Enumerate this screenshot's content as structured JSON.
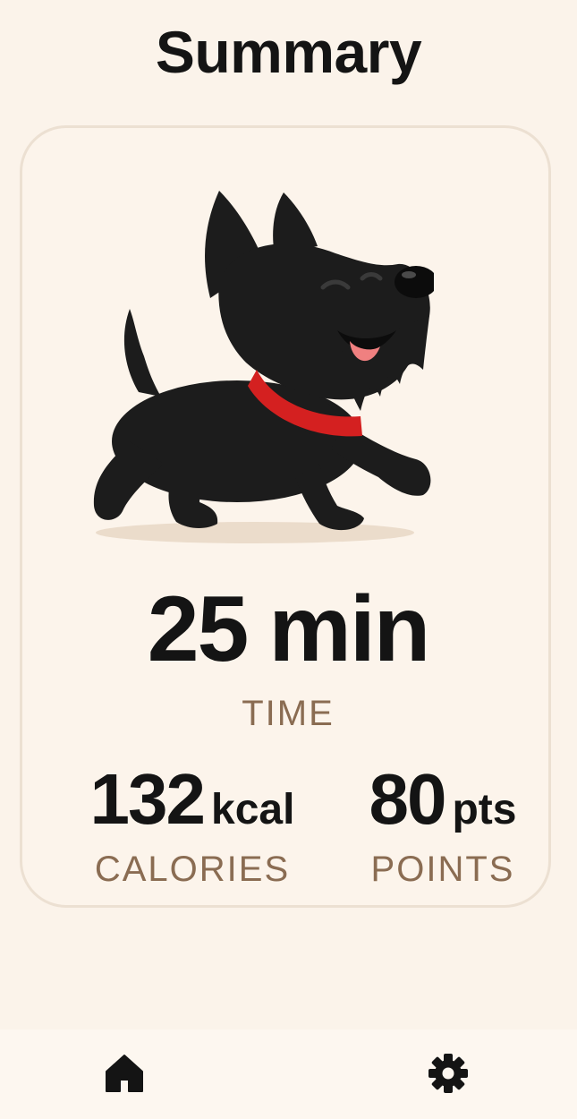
{
  "header": {
    "title": "Summary"
  },
  "summary": {
    "illustration_icon": "scottie-dog-illustration",
    "time": {
      "value": "25",
      "unit": "min",
      "label": "TIME"
    },
    "calories": {
      "value": "132",
      "unit": "kcal",
      "label": "CALORIES"
    },
    "points": {
      "value": "80",
      "unit": "pts",
      "label": "POINTS"
    }
  },
  "nav": {
    "items": [
      {
        "icon": "home-icon",
        "active": true
      },
      {
        "icon": "gear-icon",
        "active": false
      }
    ]
  },
  "colors": {
    "background": "#fbf3ea",
    "card_border": "#ece0d2",
    "label_brown": "#8a6c52",
    "text": "#141414",
    "collar_red": "#d42020"
  }
}
